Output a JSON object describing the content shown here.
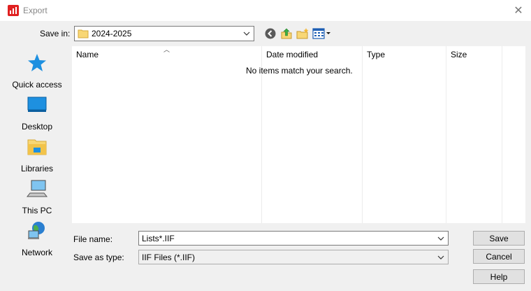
{
  "window": {
    "title": "Export"
  },
  "save_in": {
    "label": "Save in:",
    "value": "2024-2025"
  },
  "places": [
    {
      "label": "Quick access",
      "icon": "star-icon"
    },
    {
      "label": "Desktop",
      "icon": "desktop-icon"
    },
    {
      "label": "Libraries",
      "icon": "libraries-icon"
    },
    {
      "label": "This PC",
      "icon": "computer-icon"
    },
    {
      "label": "Network",
      "icon": "network-icon"
    }
  ],
  "columns": [
    "Name",
    "Date modified",
    "Type",
    "Size"
  ],
  "empty_message": "No items match your search.",
  "file_name": {
    "label": "File name:",
    "value": "Lists*.IIF"
  },
  "save_as_type": {
    "label": "Save as type:",
    "value": "IIF Files (*.IIF)"
  },
  "buttons": {
    "save": "Save",
    "cancel": "Cancel",
    "help": "Help"
  },
  "colors": {
    "accent": "#1e90e0",
    "app_icon": "#e02020",
    "folder": "#f8d775"
  }
}
